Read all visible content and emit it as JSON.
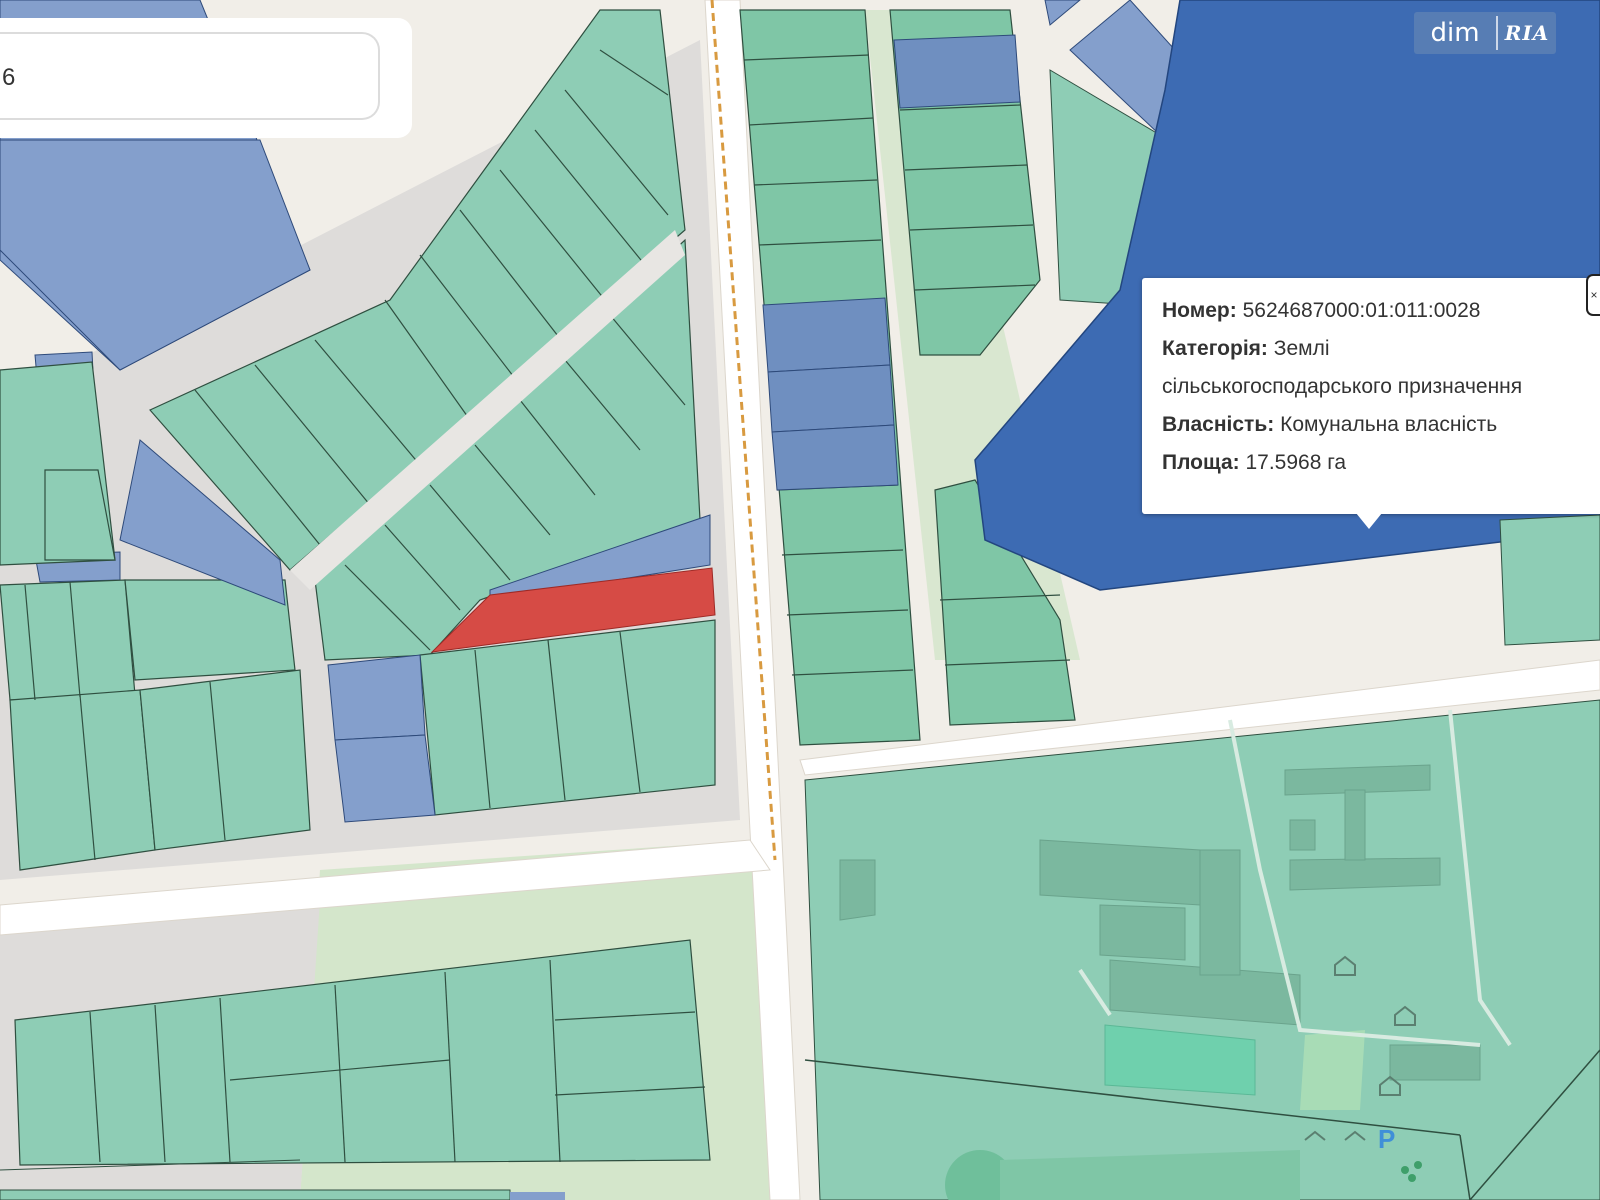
{
  "search": {
    "value": "6"
  },
  "logo": {
    "brand": "dim",
    "partner": "RIA"
  },
  "popup": {
    "number_label": "Номер:",
    "number_value": "5624687000:01:011:0028",
    "category_label": "Категорія:",
    "category_value_line1": "Землі",
    "category_value_line2": "сільськогосподарського призначення",
    "ownership_label": "Власність:",
    "ownership_value": "Комунальна власність",
    "area_label": "Площа:",
    "area_value": "17.5968 га",
    "close_glyph": "×"
  },
  "colors": {
    "background": "#f1eee8",
    "road": "#ffffff",
    "grey_area": "#dedcda",
    "parcel_green": "#8ecdb5",
    "parcel_green_dark": "#7fc6a6",
    "parcel_blue": "#849fcc",
    "parcel_blue_mid": "#6f8fc0",
    "selected_parcel": "#3d6bb3",
    "highlight_red": "#d64b45",
    "parcel_border": "#3a5a48",
    "railway": "#d89a40",
    "park_green": "#cfe4c6"
  },
  "map_icons": [
    "parking-icon",
    "building-icon",
    "playground-icon",
    "house-icon"
  ],
  "parking_label": "P"
}
